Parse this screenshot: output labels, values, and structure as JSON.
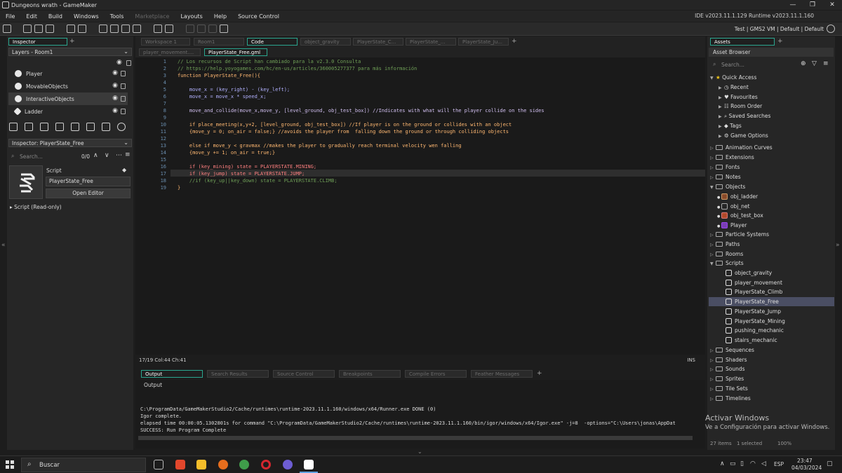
{
  "window": {
    "title": "Dungeons wrath - GameMaker",
    "controls": [
      "—",
      "❐",
      "✕"
    ]
  },
  "menu": [
    "File",
    "Edit",
    "Build",
    "Windows",
    "Tools",
    "Marketplace",
    "Layouts",
    "Help",
    "Source Control"
  ],
  "version": "IDE v2023.11.1.129  Runtime v2023.11.1.160",
  "target": "Test | GMS2 VM | Default | Default",
  "inspector": {
    "tab": "Inspector",
    "layers_dropdown": "Layers - Room1",
    "layers": [
      "Player",
      "MovableObjects",
      "InteractiveObjects",
      "Ladder"
    ],
    "inspector_dropdown": "Inspector: PlayerState_Free",
    "search_placeholder": "Search...",
    "count": "0/0",
    "script_label": "Script",
    "script_name": "PlayerState_Free",
    "open_editor": "Open Editor",
    "script_readonly": "Script (Read-only)"
  },
  "workspace_tabs": [
    "Workspace 1",
    "Room1",
    "Code",
    "object_gravity",
    "PlayerState_C...",
    "PlayerState_...",
    "PlayerState_Ju..."
  ],
  "file_tabs": [
    "player_movement....",
    "PlayerState_Free.gml"
  ],
  "code": {
    "line_numbers": [
      "1",
      "2",
      "3",
      "4",
      "5",
      "6",
      "7",
      "8",
      "9",
      "10",
      "11",
      "12",
      "13",
      "14",
      "15",
      "16",
      "17",
      "18",
      "19"
    ],
    "lines": [
      "// Los recursos de Script han cambiado para la v2.3.0 Consulta",
      "// https://help.yoyogames.com/hc/en-us/articles/360005277377 para más información",
      "function PlayerState_Free(){",
      "",
      "    move_x = (key_right) - (key_left);",
      "    move_x = move_x * speed_x;",
      "",
      "    move_and_collide(move_x,move_y, [level_ground, obj_test_box]) //Indicates with what will the player collide on the sides",
      "",
      "    if place_meeting(x,y+2, [level_ground, obj_test_box]) //If player is on the ground or collides with an object",
      "    {move_y = 0; on_air = false;} //avoids the player from  falling down the ground or through colliding objects",
      "",
      "    else if move_y < gravmax //makes the player to gradually reach terminal velocity wen falling",
      "    {move_y += 1; on_air = true;}",
      "",
      "    if (key_mining) state = PLAYERSTATE.MINING;",
      "    if (key_jump) state = PLAYERSTATE.JUMP;",
      "    //if (key_up||key_down) state = PLAYERSTATE.CLIMB;",
      "}"
    ]
  },
  "status": {
    "position": "17/19 Col:44 Ch:41",
    "mode": "INS"
  },
  "output_tabs": [
    "Output",
    "Search Results",
    "Source Control",
    "Breakpoints",
    "Compile Errors",
    "Feather Messages"
  ],
  "output": {
    "header": "Output",
    "lines": [
      "C:\\ProgramData/GameMakerStudio2/Cache/runtimes\\runtime-2023.11.1.160/windows/x64/Runner.exe DONE (0)",
      "Igor complete.",
      "elapsed time 00:00:05.1302801s for command \"C:\\ProgramData/GameMakerStudio2/Cache/runtimes\\runtime-2023.11.1.160/bin/igor/windows/x64/Igor.exe\" -j=8  -options=\"C:\\Users\\jonas\\AppDat",
      "SUCCESS: Run Program Complete"
    ]
  },
  "assets": {
    "tab": "Assets",
    "browser": "Asset Browser",
    "search_placeholder": "Search...",
    "quick_access": "Quick Access",
    "quick_items": [
      "Recent",
      "Favourites",
      "Room Order",
      "Saved Searches",
      "Tags",
      "Game Options"
    ],
    "folders_top": [
      "Animation Curves",
      "Extensions",
      "Fonts",
      "Notes"
    ],
    "objects_folder": "Objects",
    "objects": [
      "obj_ladder",
      "obj_net",
      "obj_test_box",
      "Player"
    ],
    "folders_mid": [
      "Particle Systems",
      "Paths",
      "Rooms"
    ],
    "scripts_folder": "Scripts",
    "scripts": [
      "object_gravity",
      "player_movement",
      "PlayerState_Climb",
      "PlayerState_Free",
      "PlayerState_Jump",
      "PlayerState_Mining",
      "pushing_mechanic",
      "stairs_mechanic"
    ],
    "folders_bottom": [
      "Sequences",
      "Shaders",
      "Sounds",
      "Sprites",
      "Tile Sets",
      "Timelines"
    ],
    "footer_items": "27 items",
    "footer_selected": "1 selected",
    "zoom": "100%"
  },
  "watermark": {
    "title": "Activar Windows",
    "subtitle": "Ve a Configuración para activar Windows."
  },
  "taskbar": {
    "search": "Buscar",
    "time": "23:47",
    "date": "04/03/2024",
    "lang": "ESP"
  }
}
